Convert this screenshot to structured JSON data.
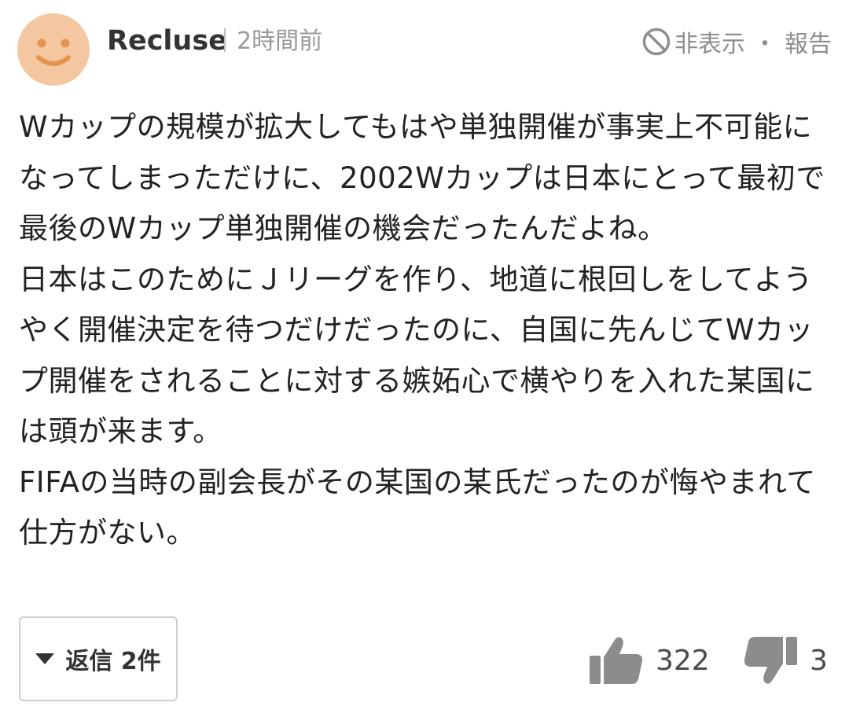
{
  "comment": {
    "author": "Recluse",
    "time_ago": "2時間前",
    "avatar_icon": "smiley-face-icon",
    "avatar_color": "#F4C7A1",
    "hide_report": {
      "hide_label": "非表示",
      "separator": "・",
      "report_label": "報告",
      "icon": "ban-icon"
    },
    "paragraphs": [
      "Wカップの規模が拡大してもはや単独開催が事実上不可能になってしまっただけに、2002Wカップは日本にとって最初で最後のWカップ単独開催の機会だったんだよね。",
      "日本はこのためにＪリーグを作り、地道に根回しをしてようやく開催決定を待つだけだったのに、自国に先んじてWカップ開催をされることに対する嫉妬心で横やりを入れた某国には頭が来ます。",
      "FIFAの当時の副会長がその某国の某氏だったのが悔やまれて仕方がない。"
    ]
  },
  "actions": {
    "replies_label": "返信 2件",
    "replies_icon": "caret-down-icon",
    "likes": "322",
    "like_icon": "thumbs-up-icon",
    "dislikes": "3",
    "dislike_icon": "thumbs-down-icon",
    "icon_color": "#8C8C8C"
  }
}
